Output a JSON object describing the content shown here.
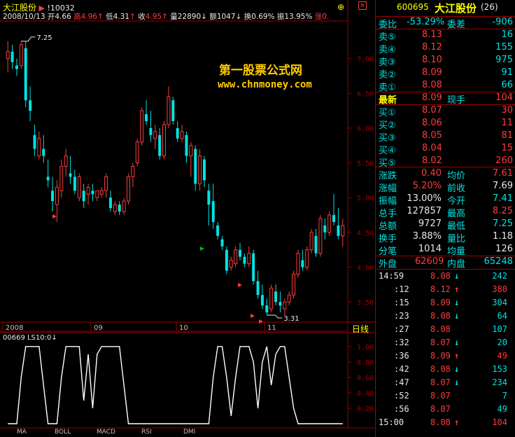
{
  "header": {
    "stock_name": "大江股份",
    "code_tag": "!10032",
    "date": "2008/10/13",
    "open_label": "开",
    "open": "4.66",
    "high_label": "高",
    "high": "4.96",
    "low_label": "低",
    "low": "4.31",
    "close_label": "收",
    "close": "4.95",
    "volume_label": "量",
    "volume": "22890",
    "amount_label": "额",
    "amount": "1047",
    "turnover_label": "换",
    "turnover": "0.69%",
    "amplitude_label": "振",
    "amplitude": "13.95%",
    "change_label": "涨",
    "change": "0.",
    "mark_high": "7.25",
    "mark_low": "3.31"
  },
  "watermark": {
    "title": "第一股票公式网",
    "url": "www.chnmoney.com"
  },
  "period_label": "日线",
  "indicator_label": "00669 LS10:0",
  "tabs": [
    "MA",
    "BOLL",
    "MACD",
    "RSI",
    "DMI"
  ],
  "chart_data": [
    {
      "type": "candlestick",
      "title": "大江股份",
      "x_labels": [
        "2008",
        "09",
        "10",
        "11"
      ],
      "y_ticks": [
        "7.00",
        "6.50",
        "6.00",
        "5.50",
        "5.00",
        "4.50",
        "4.00",
        "3.50"
      ],
      "ylim": [
        3.25,
        7.5
      ],
      "candles": [
        [
          7.0,
          7.25,
          6.8,
          7.1
        ],
        [
          7.1,
          7.2,
          6.85,
          6.95
        ],
        [
          6.9,
          7.0,
          6.75,
          6.85
        ],
        [
          6.9,
          7.25,
          6.85,
          7.2
        ],
        [
          7.15,
          7.25,
          6.3,
          6.4
        ],
        [
          6.4,
          6.6,
          6.1,
          6.25
        ],
        [
          5.9,
          6.05,
          5.6,
          5.7
        ],
        [
          5.6,
          5.95,
          5.55,
          5.85
        ],
        [
          5.7,
          5.9,
          5.5,
          5.6
        ],
        [
          5.3,
          5.55,
          5.15,
          5.25
        ],
        [
          5.1,
          5.3,
          4.8,
          4.95
        ],
        [
          4.9,
          5.25,
          4.65,
          5.15
        ],
        [
          5.1,
          5.55,
          5.0,
          5.45
        ],
        [
          5.45,
          5.7,
          5.3,
          5.6
        ],
        [
          5.35,
          5.6,
          5.2,
          5.3
        ],
        [
          5.3,
          5.4,
          5.05,
          5.1
        ],
        [
          5.0,
          5.35,
          4.95,
          5.3
        ],
        [
          5.1,
          5.2,
          4.85,
          4.95
        ],
        [
          5.05,
          5.2,
          4.9,
          5.15
        ],
        [
          5.1,
          5.2,
          4.95,
          5.05
        ],
        [
          5.0,
          5.1,
          4.95,
          5.1
        ],
        [
          5.05,
          5.15,
          5.0,
          5.1
        ],
        [
          5.1,
          5.35,
          5.0,
          5.3
        ],
        [
          5.0,
          5.1,
          4.8,
          4.85
        ],
        [
          4.8,
          4.95,
          4.75,
          4.9
        ],
        [
          4.9,
          4.95,
          4.75,
          4.8
        ],
        [
          4.8,
          5.0,
          4.75,
          4.95
        ],
        [
          4.95,
          5.35,
          4.9,
          5.3
        ],
        [
          5.3,
          5.5,
          5.15,
          5.45
        ],
        [
          5.5,
          5.85,
          5.45,
          5.8
        ],
        [
          5.8,
          6.3,
          5.75,
          6.25
        ],
        [
          6.2,
          6.4,
          6.05,
          6.1
        ],
        [
          6.0,
          6.25,
          5.8,
          5.9
        ],
        [
          5.85,
          6.05,
          5.7,
          5.95
        ],
        [
          5.9,
          6.0,
          5.55,
          5.6
        ],
        [
          5.6,
          6.1,
          5.55,
          6.05
        ],
        [
          6.05,
          6.6,
          6.0,
          6.45
        ],
        [
          6.4,
          6.45,
          6.05,
          6.1
        ],
        [
          6.0,
          6.1,
          5.8,
          5.85
        ],
        [
          5.85,
          6.05,
          5.8,
          5.95
        ],
        [
          5.9,
          5.95,
          5.5,
          5.6
        ],
        [
          5.6,
          5.8,
          5.3,
          5.75
        ],
        [
          5.7,
          5.75,
          5.1,
          5.2
        ],
        [
          5.2,
          5.7,
          5.1,
          5.6
        ],
        [
          5.55,
          5.6,
          5.15,
          5.25
        ],
        [
          5.1,
          5.2,
          4.6,
          4.9
        ],
        [
          4.95,
          5.2,
          4.55,
          4.65
        ],
        [
          4.6,
          4.65,
          4.4,
          4.45
        ],
        [
          4.4,
          4.45,
          4.25,
          4.3
        ],
        [
          4.25,
          4.3,
          3.9,
          3.95
        ],
        [
          4.0,
          4.15,
          3.95,
          4.1
        ],
        [
          4.05,
          4.3,
          4.0,
          4.25
        ],
        [
          4.25,
          4.35,
          4.1,
          4.15
        ],
        [
          4.15,
          4.2,
          4.0,
          4.05
        ],
        [
          4.05,
          4.3,
          4.0,
          4.2
        ],
        [
          4.2,
          4.25,
          3.75,
          3.8
        ],
        [
          3.8,
          3.95,
          3.55,
          3.6
        ],
        [
          3.6,
          3.75,
          3.4,
          3.45
        ],
        [
          3.45,
          3.55,
          3.31,
          3.35
        ],
        [
          3.4,
          3.75,
          3.35,
          3.7
        ],
        [
          3.65,
          3.75,
          3.45,
          3.5
        ],
        [
          3.5,
          3.65,
          3.35,
          3.45
        ],
        [
          3.4,
          3.55,
          3.3,
          3.5
        ],
        [
          3.5,
          3.65,
          3.45,
          3.6
        ],
        [
          3.6,
          3.95,
          3.55,
          3.9
        ],
        [
          3.9,
          4.25,
          3.85,
          4.2
        ],
        [
          4.1,
          4.25,
          3.95,
          4.0
        ],
        [
          4.0,
          4.3,
          3.95,
          4.25
        ],
        [
          4.25,
          4.55,
          4.2,
          4.5
        ],
        [
          4.45,
          4.55,
          4.15,
          4.2
        ],
        [
          4.2,
          4.75,
          4.15,
          4.7
        ],
        [
          4.6,
          4.7,
          4.4,
          4.5
        ],
        [
          4.5,
          4.8,
          4.45,
          4.75
        ],
        [
          4.75,
          5.05,
          4.6,
          4.65
        ],
        [
          4.6,
          4.85,
          4.4,
          4.45
        ],
        [
          4.45,
          4.7,
          4.3,
          4.6
        ]
      ]
    },
    {
      "type": "line",
      "name": "LS10",
      "y_ticks": [
        "1.00",
        "0.80",
        "0.60",
        "0.40",
        "0.20"
      ],
      "ylim": [
        0,
        1.08
      ],
      "values": [
        0,
        0,
        0,
        0.6,
        1,
        1,
        1,
        1,
        0.5,
        0,
        0,
        0,
        0.6,
        1,
        1,
        1,
        1,
        0.3,
        0.9,
        0.2,
        0.9,
        1,
        1,
        1,
        1,
        1,
        0.5,
        0,
        0,
        0,
        0,
        0,
        0,
        0,
        0,
        0,
        0,
        0,
        0,
        0,
        0,
        0,
        0,
        0,
        0,
        0,
        0.6,
        1,
        1,
        0.6,
        0.1,
        0.6,
        1,
        1,
        1,
        0.8,
        0.2,
        0.8,
        1,
        0.5,
        0.9,
        1,
        1,
        0.6,
        0.2,
        0,
        0,
        0,
        0,
        0,
        0,
        0,
        0,
        0,
        0,
        0
      ]
    }
  ],
  "quote": {
    "code": "600695",
    "name": "大江股份",
    "badge": "(26)",
    "ratio_label": "委比",
    "ratio": "-53.29%",
    "diff_label": "委差",
    "diff": "-906",
    "asks": [
      {
        "label": "卖⑤",
        "price": "8.13",
        "vol": "16"
      },
      {
        "label": "卖④",
        "price": "8.12",
        "vol": "155"
      },
      {
        "label": "卖③",
        "price": "8.10",
        "vol": "975"
      },
      {
        "label": "卖②",
        "price": "8.09",
        "vol": "91"
      },
      {
        "label": "卖①",
        "price": "8.08",
        "vol": "66"
      }
    ],
    "last_label": "最新",
    "last": "8.09",
    "now_label": "现手",
    "now": "104",
    "bids": [
      {
        "label": "买①",
        "price": "8.07",
        "vol": "30"
      },
      {
        "label": "买②",
        "price": "8.06",
        "vol": "11"
      },
      {
        "label": "买③",
        "price": "8.05",
        "vol": "81"
      },
      {
        "label": "买④",
        "price": "8.04",
        "vol": "15"
      },
      {
        "label": "买⑤",
        "price": "8.02",
        "vol": "260"
      }
    ],
    "stats": [
      {
        "l1": "涨跌",
        "v1": "0.40",
        "l2": "均价",
        "v2": "7.61",
        "c1": "#ff3c3c",
        "c2": "#ff3c3c"
      },
      {
        "l1": "涨幅",
        "v1": "5.20%",
        "l2": "前收",
        "v2": "7.69",
        "c1": "#ff3c3c",
        "c2": "#e8e8e8"
      },
      {
        "l1": "振幅",
        "v1": "13.00%",
        "l2": "今开",
        "v2": "7.41",
        "c1": "#e8e8e8",
        "c2": "#00e4e4"
      },
      {
        "l1": "总手",
        "v1": "127857",
        "l2": "最高",
        "v2": "8.25",
        "c1": "#e8e8e8",
        "c2": "#ff3c3c"
      },
      {
        "l1": "总额",
        "v1": "9727",
        "l2": "最低",
        "v2": "7.25",
        "c1": "#e8e8e8",
        "c2": "#00e4e4"
      },
      {
        "l1": "换手",
        "v1": "3.88%",
        "l2": "量比",
        "v2": "1.18",
        "c1": "#e8e8e8",
        "c2": "#e8e8e8"
      },
      {
        "l1": "分笔",
        "v1": "1014",
        "l2": "均量",
        "v2": "126",
        "c1": "#e8e8e8",
        "c2": "#e8e8e8"
      }
    ],
    "outer_label": "外盘",
    "outer": "62609",
    "inner_label": "内盘",
    "inner": "65248"
  },
  "trades": [
    {
      "time": "14:59",
      "price": "8.08",
      "dir": "down",
      "vol": "242"
    },
    {
      "time": ":12",
      "price": "8.12",
      "dir": "up",
      "vol": "380"
    },
    {
      "time": ":15",
      "price": "8.09",
      "dir": "down",
      "vol": "304"
    },
    {
      "time": ":23",
      "price": "8.08",
      "dir": "down",
      "vol": "64"
    },
    {
      "time": ":27",
      "price": "8.08",
      "dir": "none",
      "vol": "107"
    },
    {
      "time": ":32",
      "price": "8.07",
      "dir": "down",
      "vol": "20"
    },
    {
      "time": ":36",
      "price": "8.09",
      "dir": "up",
      "vol": "49"
    },
    {
      "time": ":42",
      "price": "8.08",
      "dir": "down",
      "vol": "153"
    },
    {
      "time": ":47",
      "price": "8.07",
      "dir": "down",
      "vol": "234"
    },
    {
      "time": ":52",
      "price": "8.07",
      "dir": "none",
      "vol": "7"
    },
    {
      "time": ":56",
      "price": "8.07",
      "dir": "none",
      "vol": "49"
    },
    {
      "time": "15:00",
      "price": "8.08",
      "dir": "up",
      "vol": "104"
    }
  ],
  "colors": {
    "up": "#ff3c3c",
    "down": "#00e4e4",
    "grid": "#a00000",
    "signal": "#ffffff",
    "label": "#ffff00"
  }
}
